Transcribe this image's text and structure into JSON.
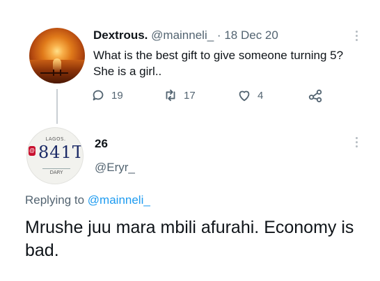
{
  "original_tweet": {
    "display_name": "Dextrous.",
    "handle": "@mainneli_",
    "separator": "·",
    "date": "18 Dec 20",
    "text_line1": "What is the best gift to give someone turning 5?",
    "text_line2": "She is a girl..",
    "actions": {
      "replies": "19",
      "retweets": "17",
      "likes": "4"
    }
  },
  "reply_tweet": {
    "display_name": "26",
    "handle": "@Eryr_",
    "avatar_plate": {
      "top_text": "LAGOS.",
      "number": "841T",
      "badge": "@",
      "bottom_text": "DARY"
    },
    "replying_prefix": "Replying to",
    "replying_handle": "@mainneli_",
    "text": "Mrushe juu mara mbili afurahi. Economy is bad."
  },
  "icons": [
    "reply-icon",
    "retweet-icon",
    "like-icon",
    "share-icon",
    "more-icon"
  ],
  "colors": {
    "link": "#1d9bf0",
    "muted": "#536471",
    "text": "#0f1419"
  }
}
